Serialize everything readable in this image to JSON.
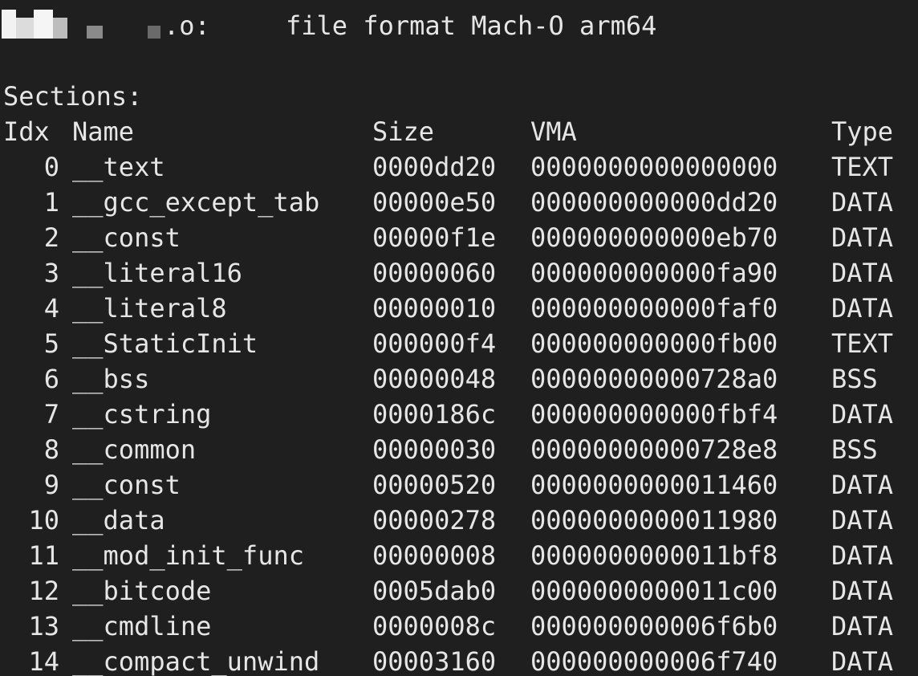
{
  "header": {
    "filename_suffix": ".o:",
    "format_label": "file format Mach-O arm64"
  },
  "sections_label": "Sections:",
  "columns": {
    "idx": "Idx",
    "name": "Name",
    "size": "Size",
    "vma": "VMA",
    "type": "Type"
  },
  "rows": [
    {
      "idx": "0",
      "name": "__text",
      "size": "0000dd20",
      "vma": "0000000000000000",
      "type": "TEXT"
    },
    {
      "idx": "1",
      "name": "__gcc_except_tab",
      "size": "00000e50",
      "vma": "000000000000dd20",
      "type": "DATA"
    },
    {
      "idx": "2",
      "name": "__const",
      "size": "00000f1e",
      "vma": "000000000000eb70",
      "type": "DATA"
    },
    {
      "idx": "3",
      "name": "__literal16",
      "size": "00000060",
      "vma": "000000000000fa90",
      "type": "DATA"
    },
    {
      "idx": "4",
      "name": "__literal8",
      "size": "00000010",
      "vma": "000000000000faf0",
      "type": "DATA"
    },
    {
      "idx": "5",
      "name": "__StaticInit",
      "size": "000000f4",
      "vma": "000000000000fb00",
      "type": "TEXT"
    },
    {
      "idx": "6",
      "name": "__bss",
      "size": "00000048",
      "vma": "00000000000728a0",
      "type": "BSS"
    },
    {
      "idx": "7",
      "name": "__cstring",
      "size": "0000186c",
      "vma": "000000000000fbf4",
      "type": "DATA"
    },
    {
      "idx": "8",
      "name": "__common",
      "size": "00000030",
      "vma": "00000000000728e8",
      "type": "BSS"
    },
    {
      "idx": "9",
      "name": "__const",
      "size": "00000520",
      "vma": "0000000000011460",
      "type": "DATA"
    },
    {
      "idx": "10",
      "name": "__data",
      "size": "00000278",
      "vma": "0000000000011980",
      "type": "DATA"
    },
    {
      "idx": "11",
      "name": "__mod_init_func",
      "size": "00000008",
      "vma": "0000000000011bf8",
      "type": "DATA"
    },
    {
      "idx": "12",
      "name": "__bitcode",
      "size": "0005dab0",
      "vma": "0000000000011c00",
      "type": "DATA"
    },
    {
      "idx": "13",
      "name": "__cmdline",
      "size": "0000008c",
      "vma": "000000000006f6b0",
      "type": "DATA"
    },
    {
      "idx": "14",
      "name": "__compact_unwind",
      "size": "00003160",
      "vma": "000000000006f740",
      "type": "DATA"
    }
  ],
  "colors": {
    "background": "#1f1f1f",
    "foreground": "#e6e6e6"
  }
}
